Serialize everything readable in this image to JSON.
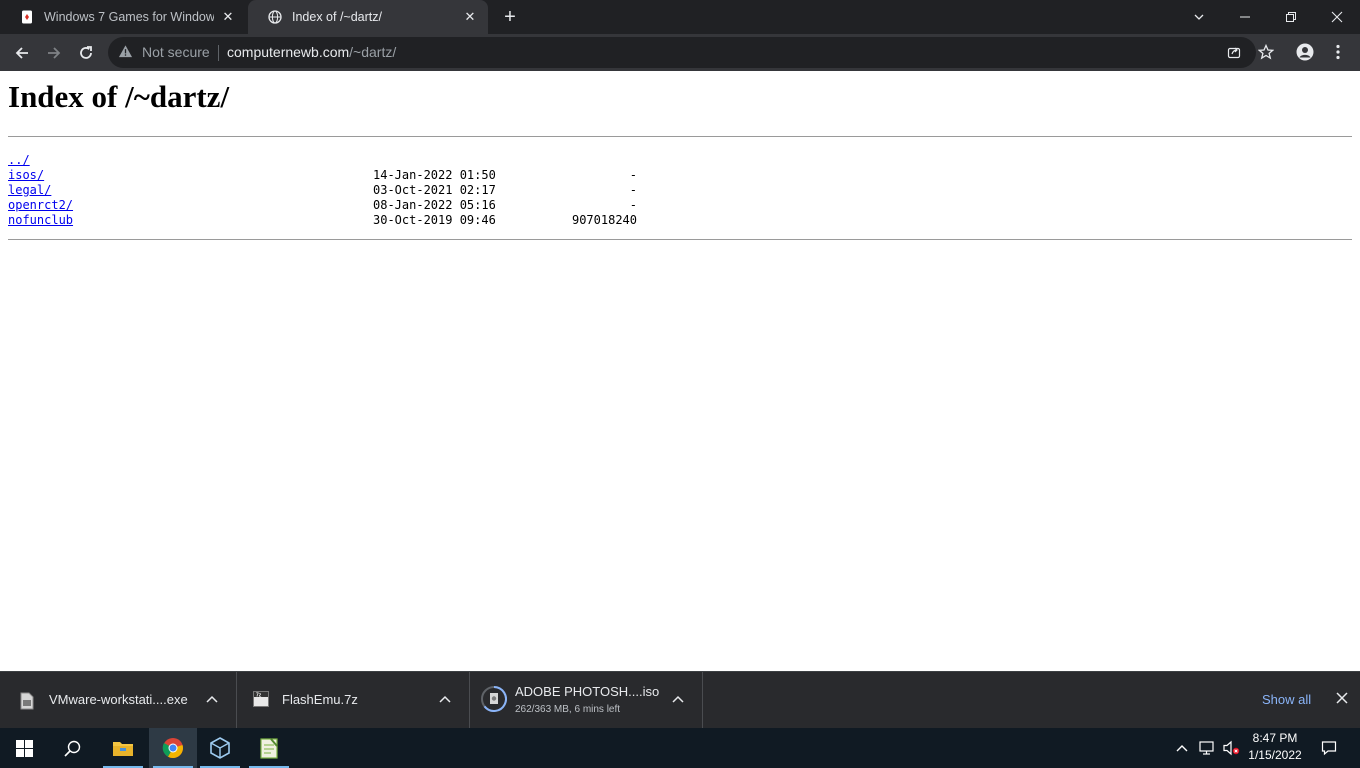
{
  "browser": {
    "tabs": [
      {
        "title": "Windows 7 Games for Windows",
        "active": false
      },
      {
        "title": "Index of /~dartz/",
        "active": true
      }
    ],
    "security_label": "Not secure",
    "url_host": "computernewb.com",
    "url_path": "/~dartz/"
  },
  "page": {
    "heading": "Index of /~dartz/",
    "entries": [
      {
        "name": "../",
        "date": "",
        "size": ""
      },
      {
        "name": "isos/",
        "date": "14-Jan-2022 01:50",
        "size": "-"
      },
      {
        "name": "legal/",
        "date": "03-Oct-2021 02:17",
        "size": "-"
      },
      {
        "name": "openrct2/",
        "date": "08-Jan-2022 05:16",
        "size": "-"
      },
      {
        "name": "nofunclub",
        "date": "30-Oct-2019 09:46",
        "size": "907018240"
      }
    ]
  },
  "downloads": {
    "items": [
      {
        "name": "VMware-workstati....exe",
        "status": "",
        "icon": "exe-file-icon"
      },
      {
        "name": "FlashEmu.7z",
        "status": "",
        "icon": "7z-archive-icon"
      },
      {
        "name": "ADOBE PHOTOSH....iso",
        "status": "262/363 MB, 6 mins left",
        "icon": "disc-image-icon"
      }
    ],
    "show_all": "Show all"
  },
  "taskbar": {
    "time": "8:47 PM",
    "date": "1/15/2022"
  },
  "colors": {
    "tab_strip": "#202124",
    "toolbar": "#35363a",
    "link": "#0000ee",
    "taskbar": "#101a23",
    "accent": "#8ab4f8"
  }
}
